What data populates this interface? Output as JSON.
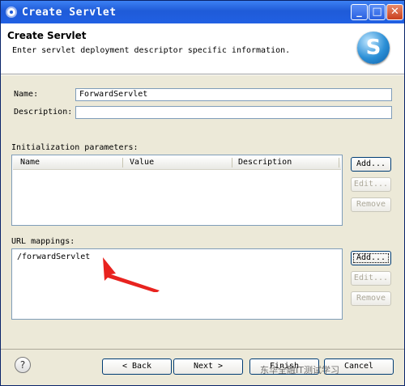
{
  "window": {
    "title": "Create Servlet"
  },
  "header": {
    "title": "Create Servlet",
    "description": "Enter servlet deployment descriptor specific information.",
    "logo_letter": "S"
  },
  "form": {
    "name_label": "Name:",
    "name_value": "ForwardServlet",
    "description_label": "Description:",
    "description_value": ""
  },
  "init_params": {
    "label": "Initialization parameters:",
    "columns": [
      "Name",
      "Value",
      "Description"
    ],
    "rows": [],
    "buttons": {
      "add": "Add...",
      "edit": "Edit...",
      "remove": "Remove"
    }
  },
  "url_mappings": {
    "label": "URL mappings:",
    "items": [
      "/forwardServlet"
    ],
    "buttons": {
      "add": "Add...",
      "edit": "Edit...",
      "remove": "Remove"
    }
  },
  "footer": {
    "back": "< Back",
    "next": "Next >",
    "finish": "Finish",
    "cancel": "Cancel"
  },
  "watermark": "东华全融IT测试学习"
}
